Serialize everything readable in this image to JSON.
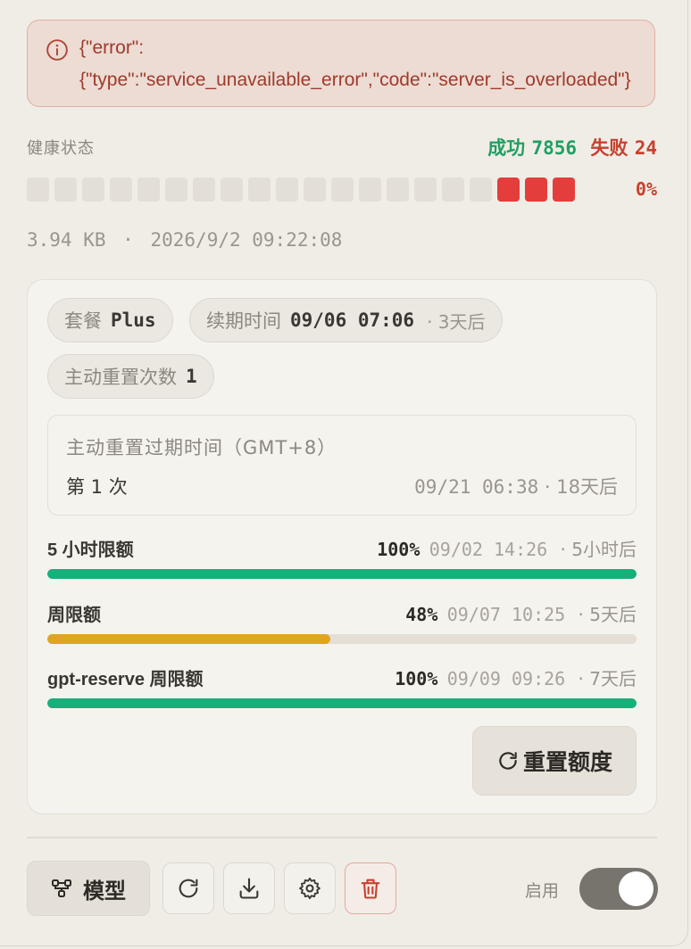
{
  "error": {
    "line1": "{\"error\":",
    "line2": "{\"type\":\"service_unavailable_error\",\"code\":\"server_is_overloaded\"}"
  },
  "health": {
    "title": "健康状态",
    "success_label": "成功",
    "success_count": "7856",
    "fail_label": "失败",
    "fail_count": "24",
    "percent": "0%",
    "segments": [
      "ok",
      "ok",
      "ok",
      "ok",
      "ok",
      "ok",
      "ok",
      "ok",
      "ok",
      "ok",
      "ok",
      "ok",
      "ok",
      "ok",
      "ok",
      "ok",
      "ok",
      "bad",
      "bad",
      "bad"
    ]
  },
  "meta": {
    "size": "3.94 KB",
    "separator": "·",
    "datetime": "2026/9/2 09:22:08"
  },
  "plan": {
    "chip_plan_label": "套餐",
    "chip_plan_value": "Plus",
    "chip_renew_label": "续期时间",
    "chip_renew_value": "09/06 07:06",
    "chip_renew_sub": "· 3天后",
    "chip_reset_label": "主动重置次数",
    "chip_reset_value": "1"
  },
  "reset_expiry": {
    "title": "主动重置过期时间（GMT+8）",
    "count": "第 1 次",
    "time": "09/21 06:38",
    "relative": "· 18天后"
  },
  "quotas": [
    {
      "label": "5 小时限额",
      "percent": "100%",
      "time": "09/02 14:26",
      "relative": "· 5小时后",
      "fill": 1.0,
      "color": "#17b07a"
    },
    {
      "label": "周限额",
      "percent": "48%",
      "time": "09/07 10:25",
      "relative": "· 5天后",
      "fill": 0.48,
      "color": "#e0a420"
    },
    {
      "label": "gpt-reserve 周限额",
      "percent": "100%",
      "time": "09/09 09:26",
      "relative": "· 7天后",
      "fill": 1.0,
      "color": "#17b07a"
    }
  ],
  "reset_button": "重置额度",
  "toolbar": {
    "model_label": "模型",
    "refresh_icon": "refresh-icon",
    "download_icon": "download-icon",
    "settings_icon": "gear-icon",
    "delete_icon": "trash-icon",
    "enable_label": "启用",
    "enabled": true
  }
}
